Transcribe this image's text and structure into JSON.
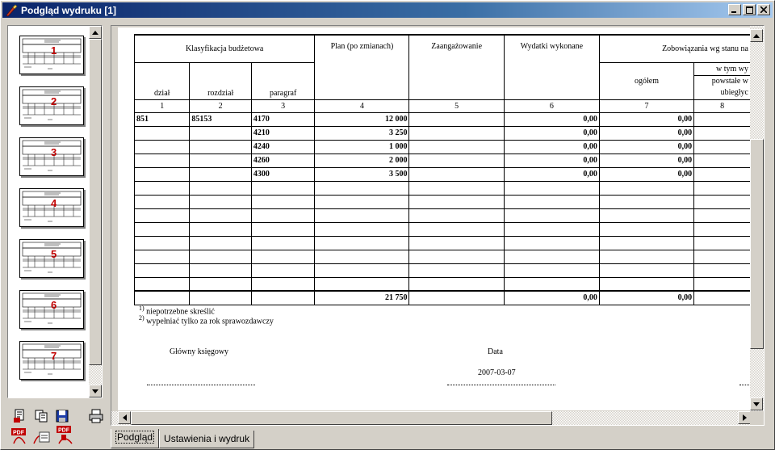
{
  "window": {
    "title": "Podgląd wydruku [1]"
  },
  "report": {
    "headers": {
      "klasyfikacja": "Klasyfikacja budżetowa",
      "dzial": "dział",
      "rozdzial": "rozdział",
      "paragraf": "paragraf",
      "plan": "Plan (po zmianach)",
      "zaangazowanie": "Zaangażowanie",
      "wydatki": "Wydatki wykonane",
      "zobowiazania": "Zobowiązania wg stanu na",
      "ogolem": "ogółem",
      "w_tym": "w tym wy",
      "powstale": "powstałe w",
      "ubieglych": "ubiegłyc"
    },
    "col_numbers": [
      "1",
      "2",
      "3",
      "4",
      "5",
      "6",
      "7",
      "8"
    ],
    "rows": [
      {
        "dzial": "851",
        "rozdzial": "85153",
        "paragraf": "4170",
        "plan": "12 000",
        "wydatki": "0,00",
        "ogolem": "0,00"
      },
      {
        "dzial": "",
        "rozdzial": "",
        "paragraf": "4210",
        "plan": "3 250",
        "wydatki": "0,00",
        "ogolem": "0,00"
      },
      {
        "dzial": "",
        "rozdzial": "",
        "paragraf": "4240",
        "plan": "1 000",
        "wydatki": "0,00",
        "ogolem": "0,00"
      },
      {
        "dzial": "",
        "rozdzial": "",
        "paragraf": "4260",
        "plan": "2 000",
        "wydatki": "0,00",
        "ogolem": "0,00"
      },
      {
        "dzial": "",
        "rozdzial": "",
        "paragraf": "4300",
        "plan": "3 500",
        "wydatki": "0,00",
        "ogolem": "0,00"
      }
    ],
    "total": {
      "plan": "21 750",
      "wydatki": "0,00",
      "ogolem": "0,00"
    },
    "footnotes": [
      {
        "mark": "1)",
        "text": "niepotrzebne skreślić"
      },
      {
        "mark": "2)",
        "text": "wypełniać tylko za rok sprawozdawczy"
      }
    ],
    "signature": {
      "accountant": "Główny księgowy",
      "date_label": "Data",
      "date_value": "2007-03-07"
    }
  },
  "thumbnails": [
    "1",
    "2",
    "3",
    "4",
    "5",
    "6",
    "7"
  ],
  "tabs": {
    "preview": "Podgląd",
    "settings": "Ustawienia i wydruk"
  },
  "icons": [
    "app-icon",
    "export-doc-icon",
    "copy-icon",
    "save-icon",
    "print-icon",
    "pdf-icon",
    "acrobat-icon",
    "pdf-sign-icon"
  ]
}
